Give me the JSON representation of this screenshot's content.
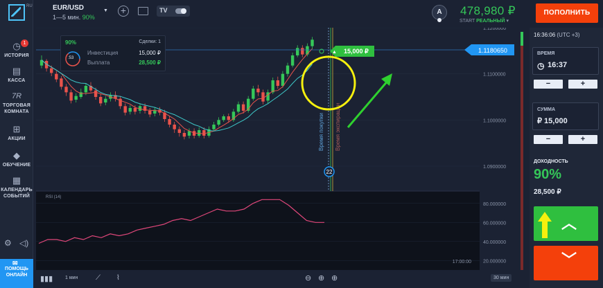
{
  "sidebar": {
    "logo_tag": "RU",
    "items": [
      {
        "label": "ИСТОРИЯ",
        "badge": "1",
        "icon": "history-icon"
      },
      {
        "label": "КАССА",
        "icon": "cash-icon"
      },
      {
        "label": "ТОРГОВАЯ КОМНАТА",
        "icon_text": "7R",
        "icon": "trading-room-icon"
      },
      {
        "label": "АКЦИИ",
        "icon": "gift-icon"
      },
      {
        "label": "ОБУЧЕНИЕ",
        "icon": "graduation-cap-icon"
      },
      {
        "label": "КАЛЕНДАРЬ СОБЫТИЙ",
        "icon": "calendar-icon"
      }
    ],
    "help": "ПОМОЩЬ ОНЛАЙН"
  },
  "header": {
    "asset": "EUR/USD",
    "timeframe": "1—5 мин.",
    "payout": "90%",
    "tv_label": "TV",
    "avatar_letter": "A",
    "balance": "478,980 ₽",
    "account_type": "START",
    "account_mode": "РЕАЛЬНЫЙ",
    "deposit_label": "ПОПОЛНИТЬ"
  },
  "trade": {
    "percent": "90%",
    "deals_label": "Сделки: 1",
    "investment_label": "Инвестиция",
    "investment": "15,000 ₽",
    "payout_label": "Выплата",
    "payout": "28,500 ₽",
    "timer": ":53",
    "marker_amount": "15,000 ₽",
    "countdown": "22",
    "purchase_time_label": "Время покупки",
    "expiry_label": "Время экспирации"
  },
  "chart_data": {
    "type": "candlestick",
    "price_ticks": [
      "1.1200000",
      "1.1100000",
      "1.1000000",
      "1.0900000"
    ],
    "current_price": "1.1180650",
    "rsi_label": "RSI (14)",
    "rsi_ticks": [
      "80.000000",
      "60.000000",
      "40.000000",
      "20.000000"
    ],
    "time_label": "17:00:00",
    "rsi_values": [
      38,
      42,
      42,
      40,
      44,
      42,
      46,
      44,
      48,
      46,
      48,
      52,
      54,
      56,
      58,
      62,
      64,
      62,
      66,
      70,
      74,
      72,
      72,
      74,
      80,
      84,
      84,
      84,
      78,
      70,
      62,
      60,
      60
    ],
    "candles": [
      {
        "o": 1.1118,
        "c": 1.113,
        "h": 1.114,
        "l": 1.1112
      },
      {
        "o": 1.1128,
        "c": 1.1112,
        "h": 1.1132,
        "l": 1.1105
      },
      {
        "o": 1.1112,
        "c": 1.1102,
        "h": 1.1118,
        "l": 1.1095
      },
      {
        "o": 1.11,
        "c": 1.1088,
        "h": 1.1106,
        "l": 1.1082
      },
      {
        "o": 1.109,
        "c": 1.1072,
        "h": 1.1095,
        "l": 1.1066
      },
      {
        "o": 1.1072,
        "c": 1.106,
        "h": 1.1078,
        "l": 1.1052
      },
      {
        "o": 1.106,
        "c": 1.1042,
        "h": 1.1066,
        "l": 1.1036
      },
      {
        "o": 1.1044,
        "c": 1.1052,
        "h": 1.1058,
        "l": 1.1038
      },
      {
        "o": 1.105,
        "c": 1.106,
        "h": 1.1068,
        "l": 1.1046
      },
      {
        "o": 1.106,
        "c": 1.1074,
        "h": 1.108,
        "l": 1.1054
      },
      {
        "o": 1.1074,
        "c": 1.1064,
        "h": 1.1082,
        "l": 1.106
      },
      {
        "o": 1.1064,
        "c": 1.105,
        "h": 1.107,
        "l": 1.1044
      },
      {
        "o": 1.105,
        "c": 1.1036,
        "h": 1.1056,
        "l": 1.103
      },
      {
        "o": 1.1038,
        "c": 1.1046,
        "h": 1.1052,
        "l": 1.1032
      },
      {
        "o": 1.1046,
        "c": 1.1054,
        "h": 1.106,
        "l": 1.104
      },
      {
        "o": 1.1054,
        "c": 1.1046,
        "h": 1.1062,
        "l": 1.104
      },
      {
        "o": 1.1046,
        "c": 1.103,
        "h": 1.1052,
        "l": 1.1024
      },
      {
        "o": 1.103,
        "c": 1.1016,
        "h": 1.1036,
        "l": 1.101
      },
      {
        "o": 1.1018,
        "c": 1.1026,
        "h": 1.1032,
        "l": 1.1012
      },
      {
        "o": 1.1026,
        "c": 1.1018,
        "h": 1.1032,
        "l": 1.1012
      },
      {
        "o": 1.102,
        "c": 1.103,
        "h": 1.1036,
        "l": 1.1014
      },
      {
        "o": 1.103,
        "c": 1.102,
        "h": 1.1036,
        "l": 1.1014
      },
      {
        "o": 1.102,
        "c": 1.1012,
        "h": 1.1026,
        "l": 1.1006
      },
      {
        "o": 1.1014,
        "c": 1.1022,
        "h": 1.1028,
        "l": 1.1008
      },
      {
        "o": 1.1022,
        "c": 1.1016,
        "h": 1.1028,
        "l": 1.101
      },
      {
        "o": 1.1016,
        "c": 1.1002,
        "h": 1.1022,
        "l": 1.0996
      },
      {
        "o": 1.1002,
        "c": 1.099,
        "h": 1.1008,
        "l": 1.0984
      },
      {
        "o": 1.099,
        "c": 1.098,
        "h": 1.0996,
        "l": 1.0972
      },
      {
        "o": 1.098,
        "c": 1.0972,
        "h": 1.0986,
        "l": 1.0964
      },
      {
        "o": 1.0972,
        "c": 1.0964,
        "h": 1.0978,
        "l": 1.0958
      },
      {
        "o": 1.0966,
        "c": 1.0976,
        "h": 1.0982,
        "l": 1.096
      },
      {
        "o": 1.0976,
        "c": 1.0966,
        "h": 1.0982,
        "l": 1.096
      },
      {
        "o": 1.0966,
        "c": 1.0978,
        "h": 1.0984,
        "l": 1.0962
      },
      {
        "o": 1.0978,
        "c": 1.0966,
        "h": 1.0984,
        "l": 1.096
      },
      {
        "o": 1.0966,
        "c": 1.098,
        "h": 1.0986,
        "l": 1.0962
      },
      {
        "o": 1.098,
        "c": 1.099,
        "h": 1.0996,
        "l": 1.0976
      },
      {
        "o": 1.099,
        "c": 1.1,
        "h": 1.1006,
        "l": 1.0986
      },
      {
        "o": 1.1,
        "c": 1.1008,
        "h": 1.1012,
        "l": 1.0996
      },
      {
        "o": 1.1008,
        "c": 1.1,
        "h": 1.1014,
        "l": 1.0994
      },
      {
        "o": 1.1,
        "c": 1.1018,
        "h": 1.1024,
        "l": 1.0996
      },
      {
        "o": 1.1018,
        "c": 1.1034,
        "h": 1.104,
        "l": 1.1014
      },
      {
        "o": 1.1034,
        "c": 1.102,
        "h": 1.104,
        "l": 1.1014
      },
      {
        "o": 1.102,
        "c": 1.1046,
        "h": 1.1052,
        "l": 1.1016
      },
      {
        "o": 1.1046,
        "c": 1.1068,
        "h": 1.1074,
        "l": 1.1042
      },
      {
        "o": 1.1068,
        "c": 1.106,
        "h": 1.1076,
        "l": 1.1052
      },
      {
        "o": 1.106,
        "c": 1.104,
        "h": 1.1066,
        "l": 1.1034
      },
      {
        "o": 1.1042,
        "c": 1.106,
        "h": 1.1066,
        "l": 1.1036
      },
      {
        "o": 1.106,
        "c": 1.1086,
        "h": 1.1092,
        "l": 1.1056
      },
      {
        "o": 1.1086,
        "c": 1.1074,
        "h": 1.1094,
        "l": 1.1068
      },
      {
        "o": 1.1074,
        "c": 1.11,
        "h": 1.1106,
        "l": 1.107
      },
      {
        "o": 1.11,
        "c": 1.1118,
        "h": 1.1124,
        "l": 1.1094
      },
      {
        "o": 1.1118,
        "c": 1.114,
        "h": 1.1146,
        "l": 1.1114
      },
      {
        "o": 1.114,
        "c": 1.1156,
        "h": 1.1162,
        "l": 1.1136
      },
      {
        "o": 1.1156,
        "c": 1.1142,
        "h": 1.1162,
        "l": 1.1136
      },
      {
        "o": 1.1142,
        "c": 1.116,
        "h": 1.1166,
        "l": 1.1138
      },
      {
        "o": 1.116,
        "c": 1.1174,
        "h": 1.118,
        "l": 1.1154
      }
    ]
  },
  "bottom": {
    "interval": "1 мин",
    "zoom_label": "30 мин"
  },
  "panel": {
    "clock": "16:36:06",
    "timezone": "(UTC +3)",
    "time_label": "ВРЕМЯ",
    "time_value": "16:37",
    "amount_label": "СУММА",
    "amount_value": "₽ 15,000",
    "minus": "−",
    "plus": "+",
    "profit_label": "ДОХОДНОСТЬ",
    "profit_pct": "90%",
    "profit_amount": "28,500 ₽"
  },
  "colors": {
    "up": "#35c759",
    "down": "#e8534b",
    "accent": "#2196f3",
    "highlight": "#f6f00e"
  }
}
